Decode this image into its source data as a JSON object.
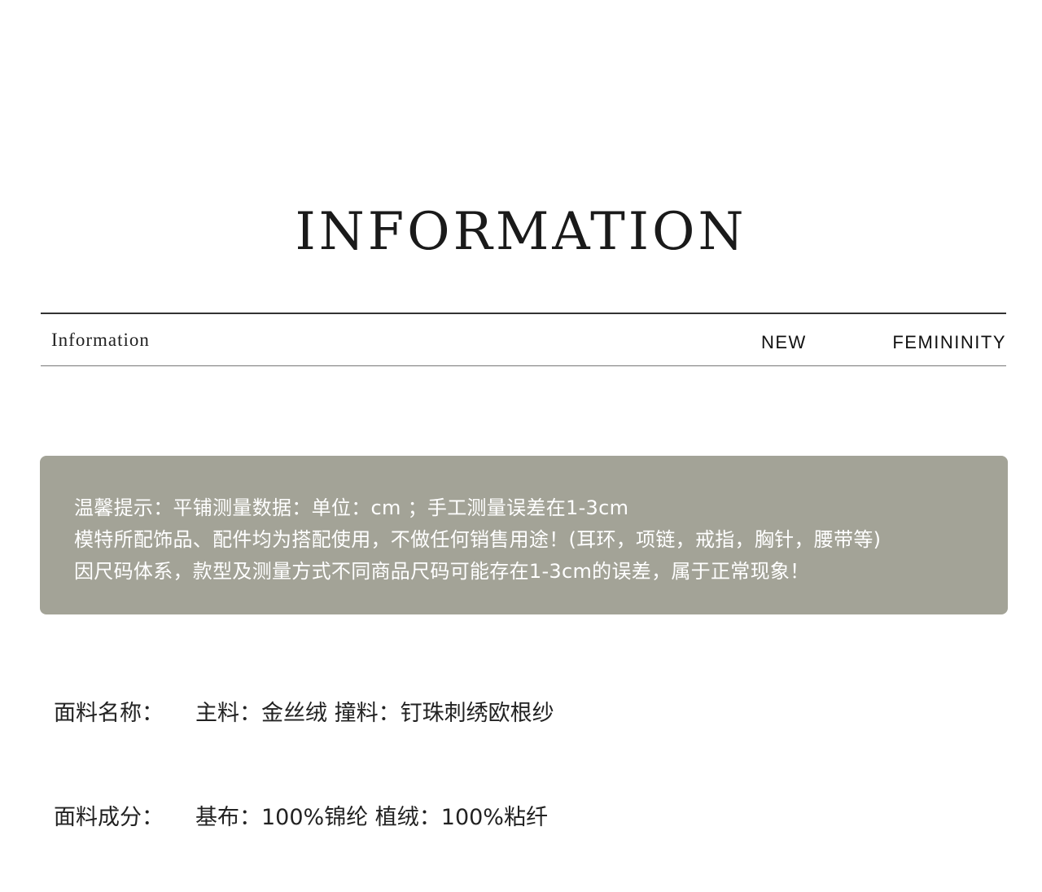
{
  "header": {
    "title": "INFORMATION",
    "subtitle_left": "Information",
    "subtitle_new": "NEW",
    "subtitle_femininity": "FEMININITY"
  },
  "notice": {
    "lines": [
      "温馨提示：平铺测量数据：单位：cm ；手工测量误差在1-3cm",
      "模特所配饰品、配件均为搭配使用，不做任何销售用途！(耳环，项链，戒指，胸针，腰带等)",
      "因尺码体系，款型及测量方式不同商品尺码可能存在1-3cm的误差，属于正常现象！"
    ],
    "background_color": "#a3a397"
  },
  "specs": [
    {
      "label": "面料名称：",
      "value": "主料：金丝绒 撞料：钉珠刺绣欧根纱"
    },
    {
      "label": "面料成分：",
      "value": "基布：100%锦纶 植绒：100%粘纤"
    }
  ]
}
